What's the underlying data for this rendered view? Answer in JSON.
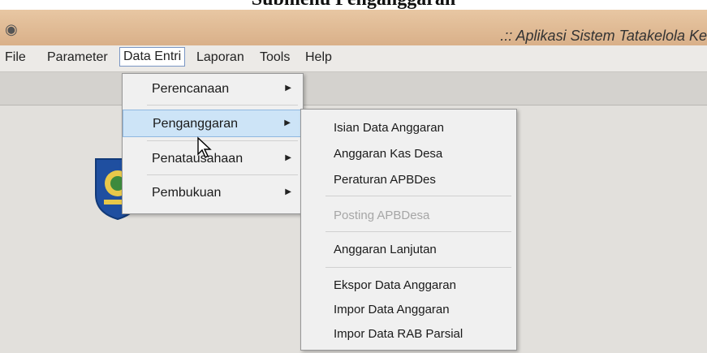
{
  "caption": "Submenu Penganggaran",
  "window": {
    "title": ".:: Aplikasi Sistem Tatakelola Ke"
  },
  "menubar": {
    "items": [
      "File",
      "Parameter",
      "Data Entri",
      "Laporan",
      "Tools",
      "Help"
    ]
  },
  "data_entri_menu": {
    "items": [
      "Perencanaan",
      "Penganggaran",
      "Penatausahaan",
      "Pembukuan"
    ]
  },
  "penganggaran_submenu": {
    "items": [
      "Isian Data Anggaran",
      "Anggaran Kas Desa",
      "Peraturan APBDes",
      "Posting APBDesa",
      "Anggaran Lanjutan",
      "Ekspor Data Anggaran",
      "Impor Data Anggaran",
      "Impor Data RAB Parsial"
    ]
  },
  "colors": {
    "titlebar": "#d9b089",
    "menu_highlight": "#cde4f7",
    "disabled_text": "#a6a6a6"
  }
}
